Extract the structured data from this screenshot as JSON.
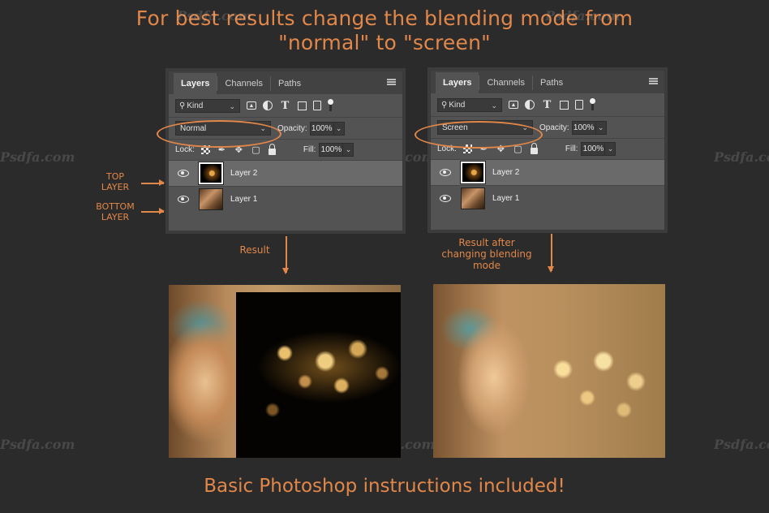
{
  "headline": {
    "line1": "For best results change the blending mode from",
    "line2": "\"normal\" to \"screen\""
  },
  "footer": "Basic Photoshop instructions included!",
  "panels": [
    {
      "tabs": [
        "Layers",
        "Channels",
        "Paths"
      ],
      "active_tab": "Layers",
      "filter_kind": "Kind",
      "blend_mode": "Normal",
      "opacity_label": "Opacity:",
      "opacity_value": "100%",
      "lock_label": "Lock:",
      "fill_label": "Fill:",
      "fill_value": "100%",
      "layers": [
        {
          "name": "Layer 2",
          "selected": true
        },
        {
          "name": "Layer 1",
          "selected": false
        }
      ]
    },
    {
      "tabs": [
        "Layers",
        "Channels",
        "Paths"
      ],
      "active_tab": "Layers",
      "filter_kind": "Kind",
      "blend_mode": "Screen",
      "opacity_label": "Opacity:",
      "opacity_value": "100%",
      "lock_label": "Lock:",
      "fill_label": "Fill:",
      "fill_value": "100%",
      "layers": [
        {
          "name": "Layer 2",
          "selected": true
        },
        {
          "name": "Layer 1",
          "selected": false
        }
      ]
    }
  ],
  "annotations": {
    "top_layer": "TOP\nLAYER",
    "bottom_layer": "BOTTOM\nLAYER",
    "result_left": "Result",
    "result_right": "Result after\nchanging blending\nmode"
  },
  "watermark_text": "Psdfa.com",
  "colors": {
    "accent": "#e2874a",
    "background": "#2b2b2b",
    "panel": "#535353"
  },
  "icons": {
    "filter": [
      "image-filter-icon",
      "adjustment-filter-icon",
      "type-filter-icon",
      "shape-filter-icon",
      "smart-object-filter-icon",
      "filter-toggle-icon"
    ],
    "lock": [
      "lock-transparent-icon",
      "lock-image-icon",
      "lock-position-icon",
      "lock-artboard-icon",
      "lock-all-icon"
    ]
  }
}
